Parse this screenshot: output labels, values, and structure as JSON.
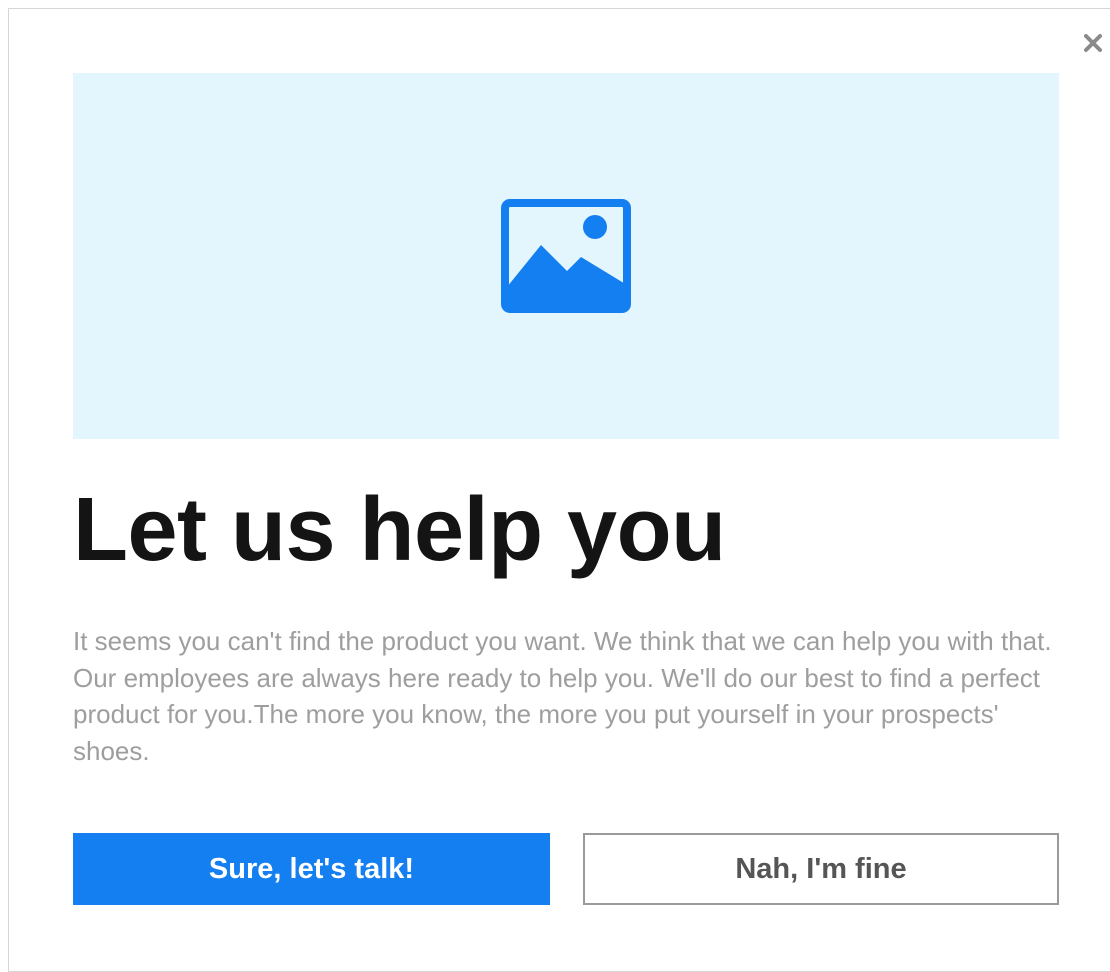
{
  "dialog": {
    "close_icon": "close-icon",
    "hero_icon": "image-placeholder-icon",
    "title": "Let us help you",
    "body": "It seems you can't find the product you want. We think that we can help you with that. Our employees are always here ready to help you. We'll do our best to find a perfect product for you.The more you know, the more you put yourself in your prospects' shoes.",
    "primary_button": "Sure, let's talk!",
    "secondary_button": "Nah, I'm fine"
  },
  "colors": {
    "hero_background": "#e3f5fd",
    "accent": "#137ff0",
    "title_text": "#141414",
    "body_text": "#9e9e9e",
    "secondary_border": "#9a9a9a"
  }
}
